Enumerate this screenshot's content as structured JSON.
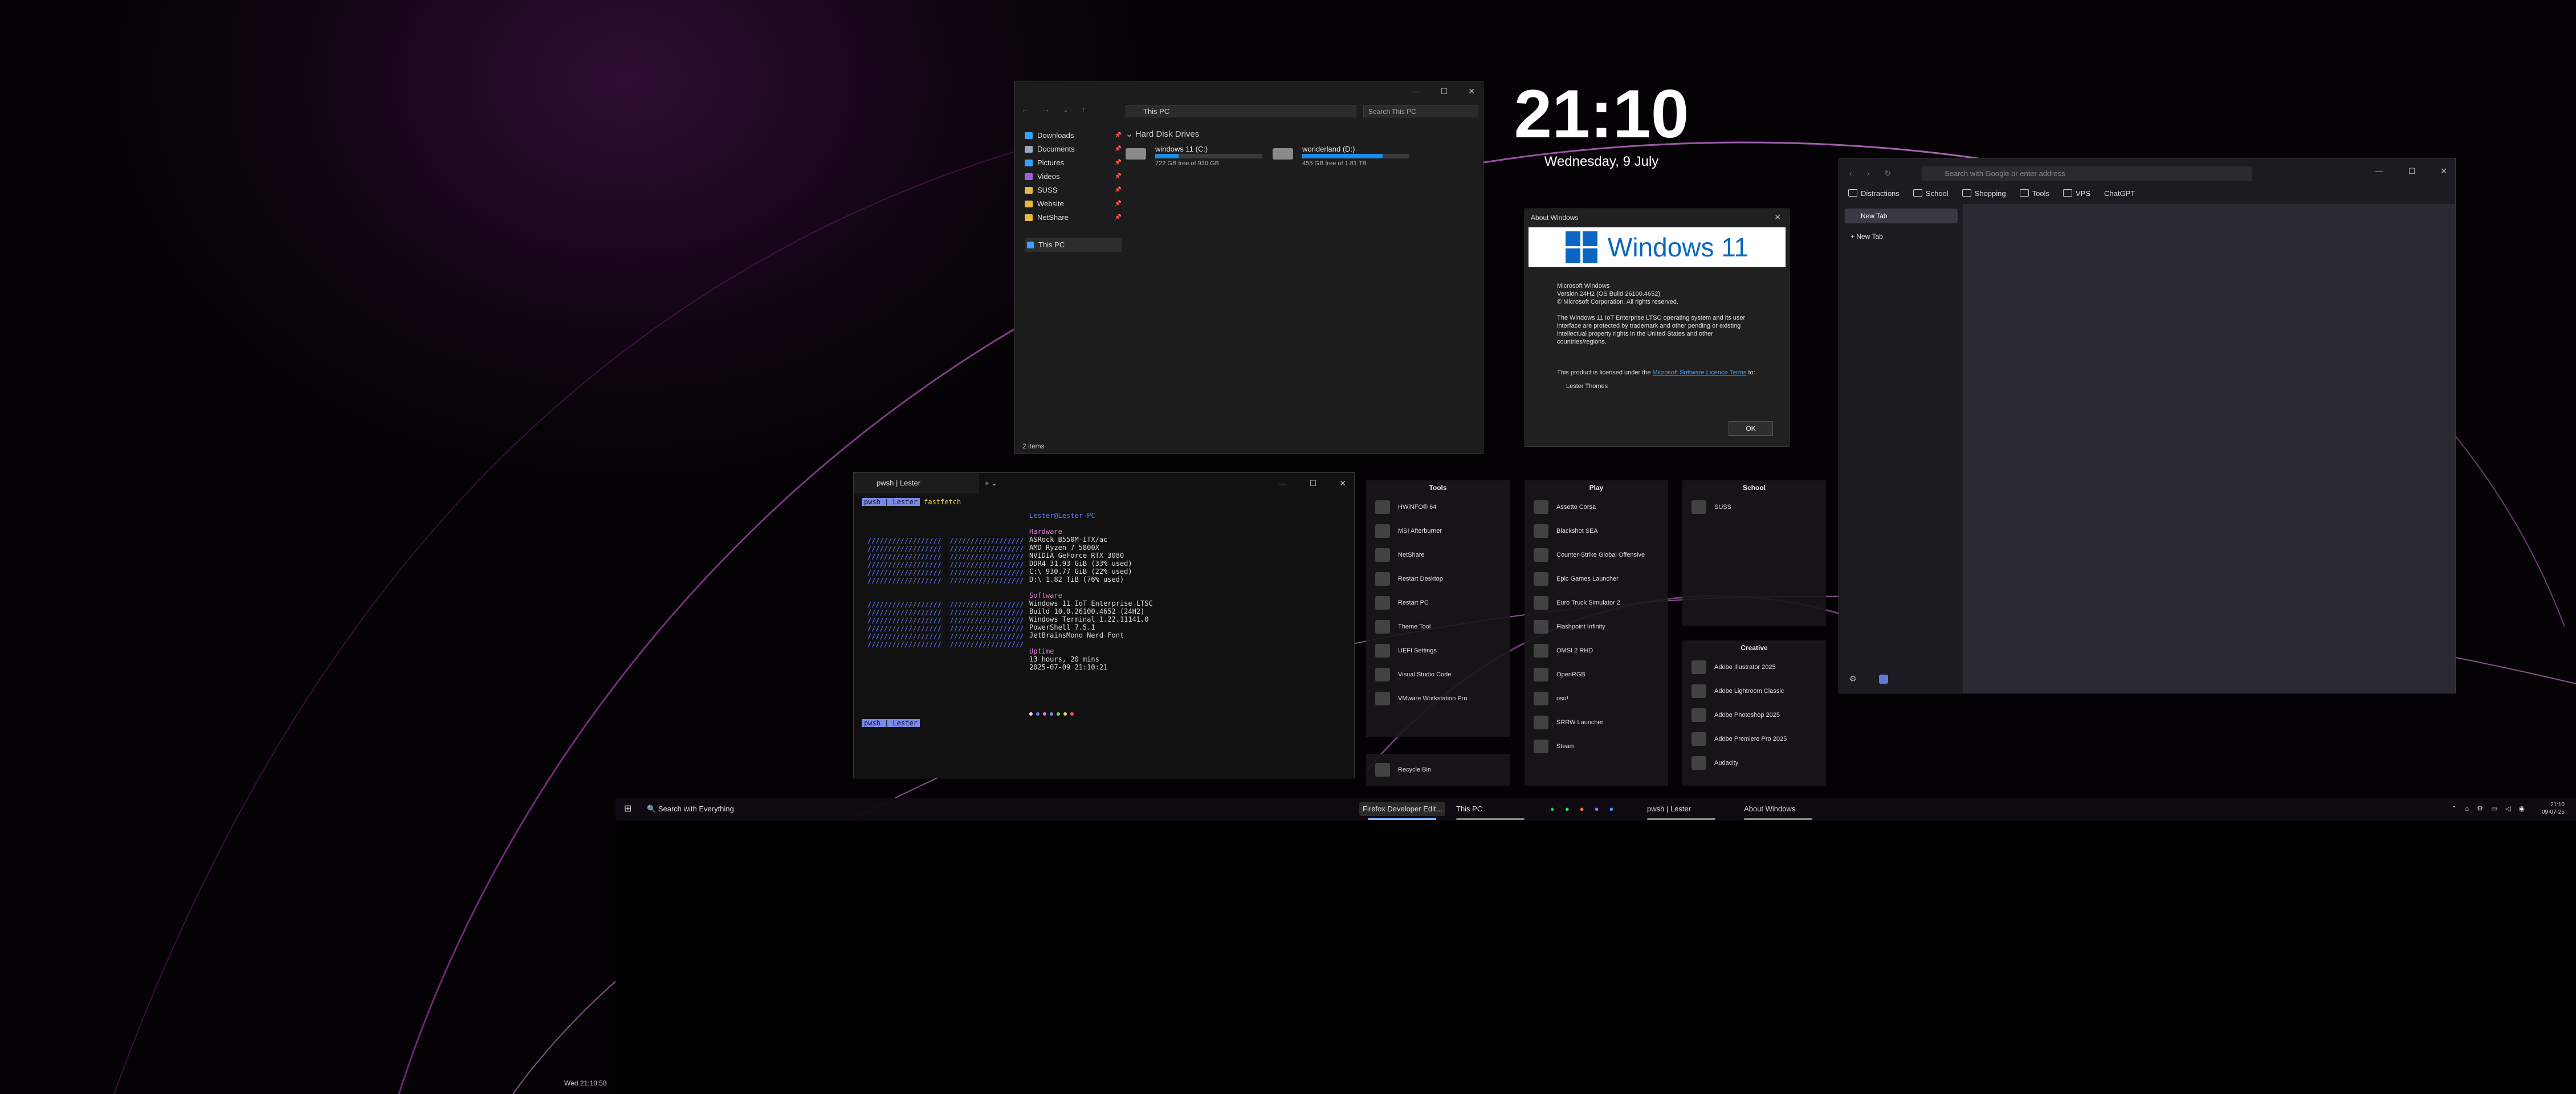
{
  "explorer": {
    "address": "This PC",
    "search_placeholder": "Search This PC",
    "sidebar": [
      {
        "label": "Downloads",
        "color": "#3aa0ff"
      },
      {
        "label": "Documents",
        "color": "#9aa8c0"
      },
      {
        "label": "Pictures",
        "color": "#3aa0ff"
      },
      {
        "label": "Videos",
        "color": "#a060e0"
      },
      {
        "label": "SUSS",
        "color": "#e6b84a"
      },
      {
        "label": "Website",
        "color": "#e6b84a"
      },
      {
        "label": "NetShare",
        "color": "#e6b84a"
      }
    ],
    "this_pc": "This PC",
    "group_title": "Hard Disk Drives",
    "drives": [
      {
        "name": "windows 11 (C:)",
        "free": "722 GB free of 930 GB",
        "used_fraction": 0.22
      },
      {
        "name": "wonderland (D:)",
        "free": "455 GB free of 1.81 TB",
        "used_fraction": 0.75
      }
    ],
    "status": "2 items"
  },
  "clock": {
    "time": "21:10",
    "date": "Wednesday, 9 July"
  },
  "about": {
    "title": "About Windows",
    "banner": "Windows 11",
    "line1": "Microsoft Windows",
    "line2": "Version 24H2 (OS Build 26100.4652)",
    "line3": "© Microsoft Corporation. All rights reserved.",
    "para": "The Windows 11 IoT Enterprise LTSC operating system and its user interface are protected by trademark and other pending or existing intellectual property rights in the United States and other countries/regions.",
    "licence_pre": "This product is licensed under the",
    "licence_link": "Microsoft Software Licence Terms",
    "licence_post": "to:",
    "user": "Lester Thomes",
    "ok": "OK"
  },
  "firefox": {
    "url_placeholder": "Search with Google or enter address",
    "bookmarks": [
      "Distractions",
      "School",
      "Shopping",
      "Tools",
      "VPS",
      "ChatGPT"
    ],
    "active_tab": "New Tab",
    "new_tab": "New Tab"
  },
  "terminal": {
    "tab_title": "pwsh | Lester",
    "prompt_user": "pwsh | Lester",
    "command": "fastfetch",
    "userhost": "Lester@Lester-PC",
    "hardware_hdr": "Hardware",
    "hw": [
      "ASRock B550M-ITX/ac",
      "AMD Ryzen 7 5800X",
      "NVIDIA GeForce RTX 3080",
      "DDR4 31.93 GiB (33% used)",
      "C:\\ 930.77 GiB (22% used)",
      "D:\\ 1.82 TiB (76% used)"
    ],
    "software_hdr": "Software",
    "sw": [
      "Windows 11 IoT Enterprise LTSC",
      "Build 10.0.26100.4652 (24H2)",
      "Windows Terminal 1.22.11141.0",
      "PowerShell 7.5.1",
      "JetBrainsMono Nerd Font"
    ],
    "uptime_hdr": "Uptime",
    "uptime": [
      "13 hours, 20 mins",
      "2025-07-09 21:10:21"
    ],
    "palette": [
      "#e0e0e0",
      "#5e7bff",
      "#e57bd8",
      "#7a88e8",
      "#5ce05c",
      "#e8d44d",
      "#e05c5c"
    ]
  },
  "panels": {
    "tools": {
      "title": "Tools",
      "items": [
        "HWiNFO® 64",
        "MSI Afterburner",
        "NetShare",
        "Restart Desktop",
        "Restart PC",
        "Theme Tool",
        "UEFI Settings",
        "Visual Studio Code",
        "VMware Workstation Pro"
      ]
    },
    "play": {
      "title": "Play",
      "items": [
        "Assetto Corsa",
        "Blackshot SEA",
        "Counter-Strike Global Offensive",
        "Epic Games Launcher",
        "Euro Truck Simulator 2",
        "Flashpoint Infinity",
        "OMSI 2 RHD",
        "OpenRGB",
        "osu!",
        "SRRW Launcher",
        "Steam"
      ]
    },
    "school": {
      "title": "School",
      "items": [
        "SUSS"
      ]
    },
    "creative": {
      "title": "Creative",
      "items": [
        "Adobe Illustrator 2025",
        "Adobe Lightroom Classic",
        "Adobe Photoshop 2025",
        "Adobe Premiere Pro 2025",
        "Audacity"
      ]
    },
    "recycle": "Recycle Bin"
  },
  "taskbar": {
    "search": "Search with Everything",
    "apps": [
      "Firefox Developer Edit...",
      "This PC",
      "pwsh | Lester",
      "About Windows"
    ],
    "tray_time": "21:10",
    "tray_date": "09-07-25"
  },
  "bottom_clock": "Wed 21:10:58"
}
